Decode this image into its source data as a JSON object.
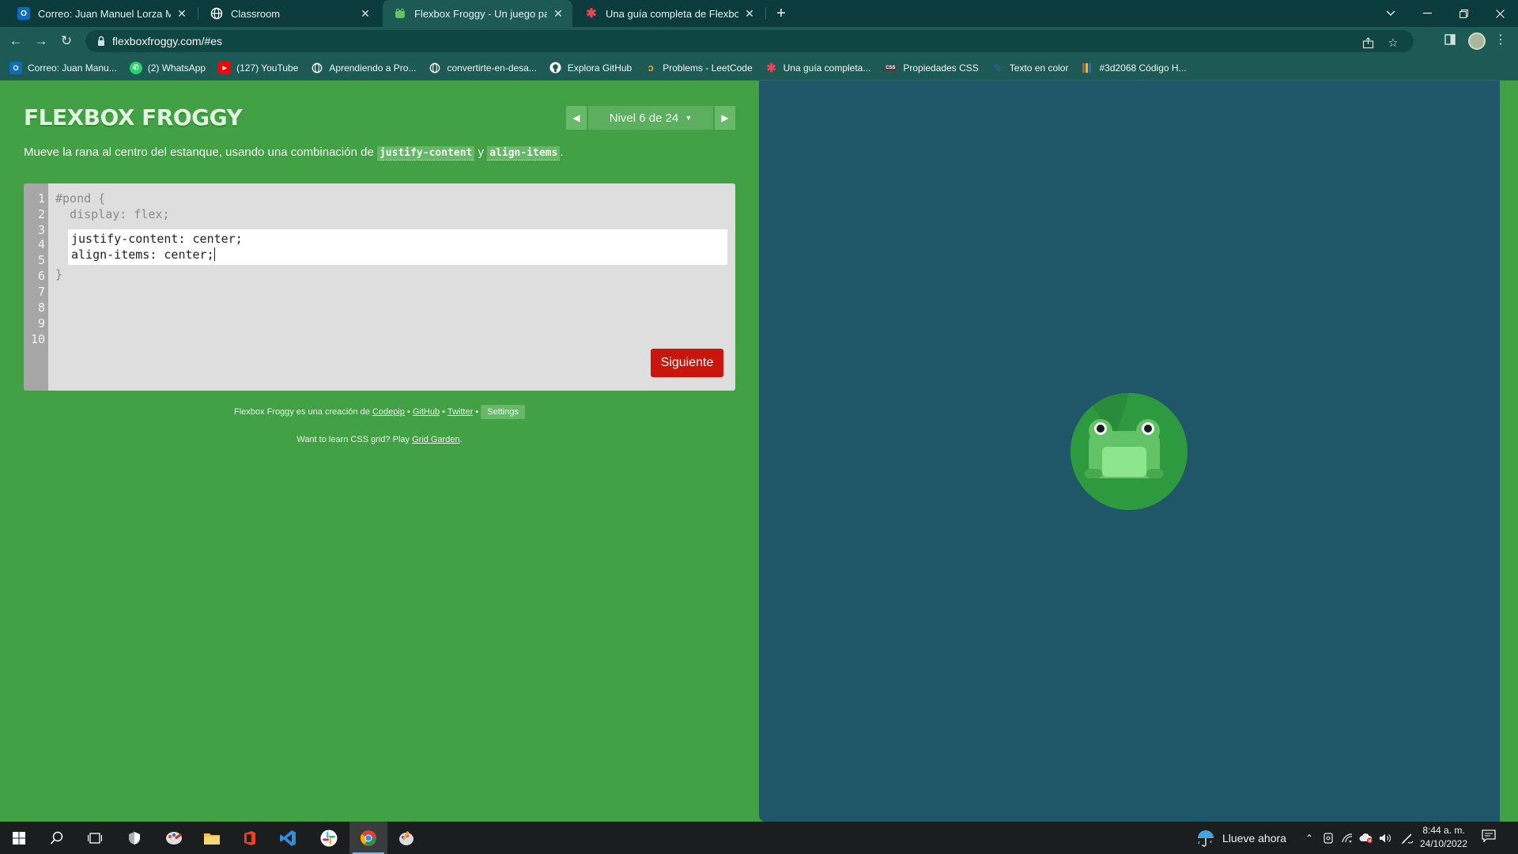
{
  "browser": {
    "tabs": [
      {
        "title": "Correo: Juan Manuel Lorza Mend",
        "icon": "outlook-icon",
        "color": "#0f6cbd",
        "active": false
      },
      {
        "title": "Classroom",
        "icon": "globe-icon",
        "color": "#ffffff",
        "active": false
      },
      {
        "title": "Flexbox Froggy - Un juego para a",
        "icon": "frog-icon",
        "color": "#42a144",
        "active": true
      },
      {
        "title": "Una guía completa de Flexbox | T",
        "icon": "css-tricks-icon",
        "color": "#e8445a",
        "active": false
      }
    ],
    "url": "flexboxfroggy.com/#es",
    "bookmarks": [
      {
        "label": "Correo: Juan Manu...",
        "icon": "outlook-icon",
        "color": "#0f6cbd"
      },
      {
        "label": "(2) WhatsApp",
        "icon": "whatsapp-icon",
        "color": "#25d366"
      },
      {
        "label": "(127) YouTube",
        "icon": "youtube-icon",
        "color": "#ff0000"
      },
      {
        "label": "Aprendiendo a Pro...",
        "icon": "globe-icon",
        "color": "#ffffff"
      },
      {
        "label": "convertirte-en-desa...",
        "icon": "globe-icon",
        "color": "#ffffff"
      },
      {
        "label": "Explora GitHub",
        "icon": "github-icon",
        "color": "#ffffff"
      },
      {
        "label": "Problems - LeetCode",
        "icon": "leetcode-icon",
        "color": "#f5a623"
      },
      {
        "label": "Una guía completa...",
        "icon": "css-tricks-icon",
        "color": "#e8445a"
      },
      {
        "label": "Propiedades CSS",
        "icon": "css-icon",
        "color": "#444444"
      },
      {
        "label": "Texto en color",
        "icon": "pen-icon",
        "color": "#2b5c8a"
      },
      {
        "label": "#3d2068 Código H...",
        "icon": "palette-icon",
        "color": "#e94a2c"
      }
    ]
  },
  "game": {
    "logo": "FLEXBOX FROGGY",
    "level_label": "Nivel 6 de 24",
    "instructions": {
      "before": "Mueve la rana al centro del estanque, usando una combinación de ",
      "code1": "justify-content",
      "middle": " y ",
      "code2": "align-items",
      "after": "."
    },
    "editor": {
      "line_numbers": [
        "1",
        "2",
        "3",
        "4",
        "5",
        "6",
        "7",
        "8",
        "9",
        "10"
      ],
      "line1": "#pond {",
      "line2": "  display: flex;",
      "input_line1": "justify-content: center;",
      "input_line2": "align-items: center;",
      "line5": "}"
    },
    "next_button": "Siguiente",
    "credits": {
      "prefix": "Flexbox Froggy es una creación de ",
      "codepip": "Codepip",
      "sep1": " • ",
      "github": "GitHub",
      "sep2": " • ",
      "twitter": "Twitter",
      "sep3": " • ",
      "settings": "Settings"
    },
    "learn": {
      "prefix": "Want to learn CSS grid? Play ",
      "link": "Grid Garden",
      "suffix": "."
    },
    "colors": {
      "page_green": "#42a144",
      "pond_blue": "#1f5768",
      "lilypad": "#2e9a3f",
      "frog": "#62c466",
      "next_red": "#c9150c"
    }
  },
  "taskbar": {
    "weather": "Llueve ahora",
    "time": "8:44 a. m.",
    "date": "24/10/2022"
  }
}
